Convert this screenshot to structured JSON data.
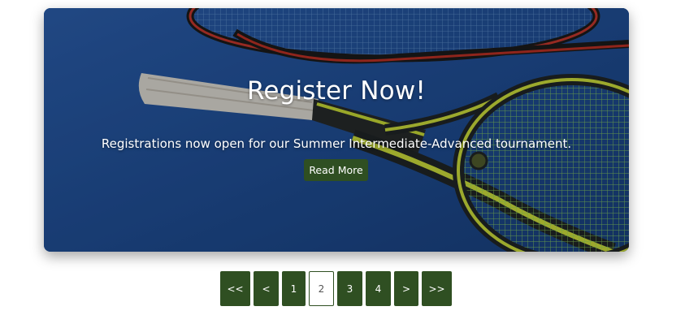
{
  "banner": {
    "title": "Register Now!",
    "text": "Registrations now open for our Summer Intermediate-Advanced tournament.",
    "button_label": "Read More",
    "image_subject": "tennis rackets on blue court"
  },
  "pagination": {
    "first_label": "<<",
    "prev_label": "<",
    "pages": [
      "1",
      "2",
      "3",
      "4"
    ],
    "active_page": "2",
    "next_label": ">",
    "last_label": ">>"
  },
  "colors": {
    "accent": "#2f4f22",
    "banner_bg": "#1b4a8a",
    "text_on_banner": "#ffffff"
  }
}
